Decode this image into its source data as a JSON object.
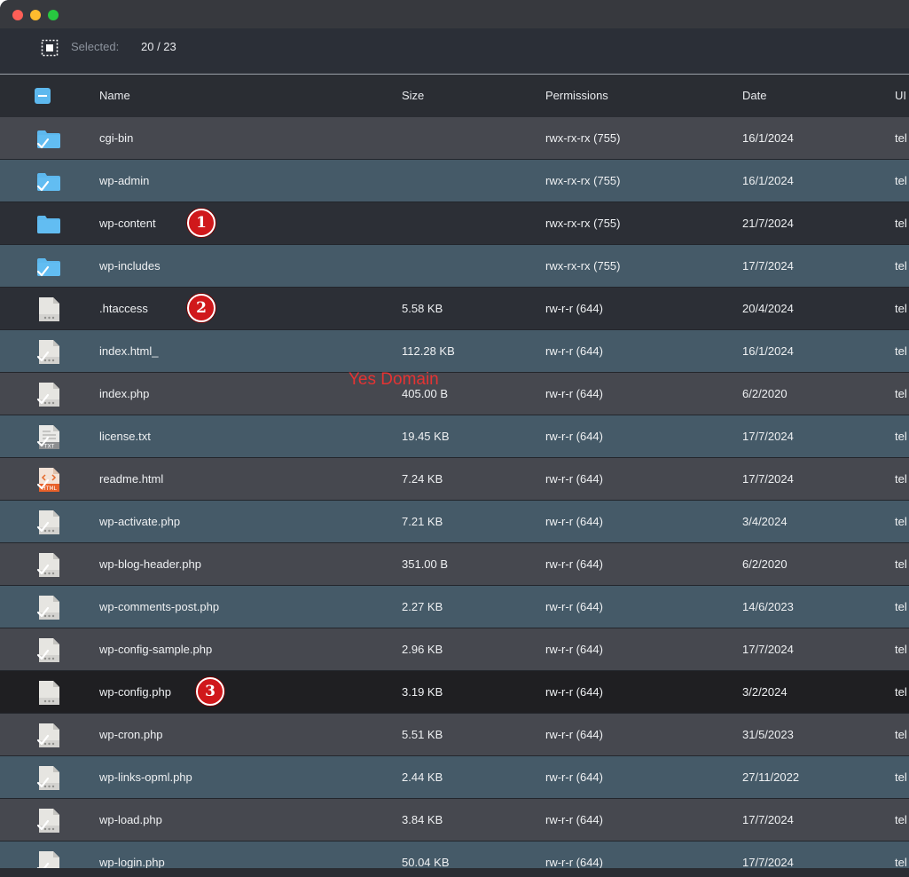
{
  "toolbar": {
    "selected_label": "Selected:",
    "selected_value": "20 / 23"
  },
  "columns": {
    "name": "Name",
    "size": "Size",
    "permissions": "Permissions",
    "date": "Date",
    "uid": "UI"
  },
  "colors": {
    "selected_row_a": "#46484f",
    "selected_row_b": "#455a68",
    "unselected_row": "#2c2f36",
    "highlight_row": "#1f1f22",
    "folder": "#5db8ee",
    "badge": "#d0181b",
    "watermark": "#e53333"
  },
  "rows": [
    {
      "name": "cgi-bin",
      "size": "",
      "permissions": "rwx-rx-rx (755)",
      "date": "16/1/2024",
      "uid": "tel",
      "icon": "folder-icon",
      "selected": true,
      "badge": ""
    },
    {
      "name": "wp-admin",
      "size": "",
      "permissions": "rwx-rx-rx (755)",
      "date": "16/1/2024",
      "uid": "tel",
      "icon": "folder-icon",
      "selected": true,
      "badge": ""
    },
    {
      "name": "wp-content",
      "size": "",
      "permissions": "rwx-rx-rx (755)",
      "date": "21/7/2024",
      "uid": "tel",
      "icon": "folder-icon",
      "selected": false,
      "badge": "1"
    },
    {
      "name": "wp-includes",
      "size": "",
      "permissions": "rwx-rx-rx (755)",
      "date": "17/7/2024",
      "uid": "tel",
      "icon": "folder-icon",
      "selected": true,
      "badge": ""
    },
    {
      "name": ".htaccess",
      "size": "5.58 KB",
      "permissions": "rw-r-r (644)",
      "date": "20/4/2024",
      "uid": "tel",
      "icon": "file-icon",
      "selected": false,
      "badge": "2"
    },
    {
      "name": "index.html_",
      "size": "112.28 KB",
      "permissions": "rw-r-r (644)",
      "date": "16/1/2024",
      "uid": "tel",
      "icon": "file-icon",
      "selected": true,
      "badge": ""
    },
    {
      "name": "index.php",
      "size": "405.00 B",
      "permissions": "rw-r-r (644)",
      "date": "6/2/2020",
      "uid": "tel",
      "icon": "file-icon",
      "selected": true,
      "badge": ""
    },
    {
      "name": "license.txt",
      "size": "19.45 KB",
      "permissions": "rw-r-r (644)",
      "date": "17/7/2024",
      "uid": "tel",
      "icon": "txt-file-icon",
      "selected": true,
      "badge": ""
    },
    {
      "name": "readme.html",
      "size": "7.24 KB",
      "permissions": "rw-r-r (644)",
      "date": "17/7/2024",
      "uid": "tel",
      "icon": "html-file-icon",
      "selected": true,
      "badge": ""
    },
    {
      "name": "wp-activate.php",
      "size": "7.21 KB",
      "permissions": "rw-r-r (644)",
      "date": "3/4/2024",
      "uid": "tel",
      "icon": "file-icon",
      "selected": true,
      "badge": ""
    },
    {
      "name": "wp-blog-header.php",
      "size": "351.00 B",
      "permissions": "rw-r-r (644)",
      "date": "6/2/2020",
      "uid": "tel",
      "icon": "file-icon",
      "selected": true,
      "badge": ""
    },
    {
      "name": "wp-comments-post.php",
      "size": "2.27 KB",
      "permissions": "rw-r-r (644)",
      "date": "14/6/2023",
      "uid": "tel",
      "icon": "file-icon",
      "selected": true,
      "badge": ""
    },
    {
      "name": "wp-config-sample.php",
      "size": "2.96 KB",
      "permissions": "rw-r-r (644)",
      "date": "17/7/2024",
      "uid": "tel",
      "icon": "file-icon",
      "selected": true,
      "badge": ""
    },
    {
      "name": "wp-config.php",
      "size": "3.19 KB",
      "permissions": "rw-r-r (644)",
      "date": "3/2/2024",
      "uid": "tel",
      "icon": "file-icon",
      "selected": false,
      "badge": "3"
    },
    {
      "name": "wp-cron.php",
      "size": "5.51 KB",
      "permissions": "rw-r-r (644)",
      "date": "31/5/2023",
      "uid": "tel",
      "icon": "file-icon",
      "selected": true,
      "badge": ""
    },
    {
      "name": "wp-links-opml.php",
      "size": "2.44 KB",
      "permissions": "rw-r-r (644)",
      "date": "27/11/2022",
      "uid": "tel",
      "icon": "file-icon",
      "selected": true,
      "badge": ""
    },
    {
      "name": "wp-load.php",
      "size": "3.84 KB",
      "permissions": "rw-r-r (644)",
      "date": "17/7/2024",
      "uid": "tel",
      "icon": "file-icon",
      "selected": true,
      "badge": ""
    },
    {
      "name": "wp-login.php",
      "size": "50.04 KB",
      "permissions": "rw-r-r (644)",
      "date": "17/7/2024",
      "uid": "tel",
      "icon": "file-icon",
      "selected": true,
      "badge": ""
    }
  ],
  "watermark": "Yes Domain"
}
